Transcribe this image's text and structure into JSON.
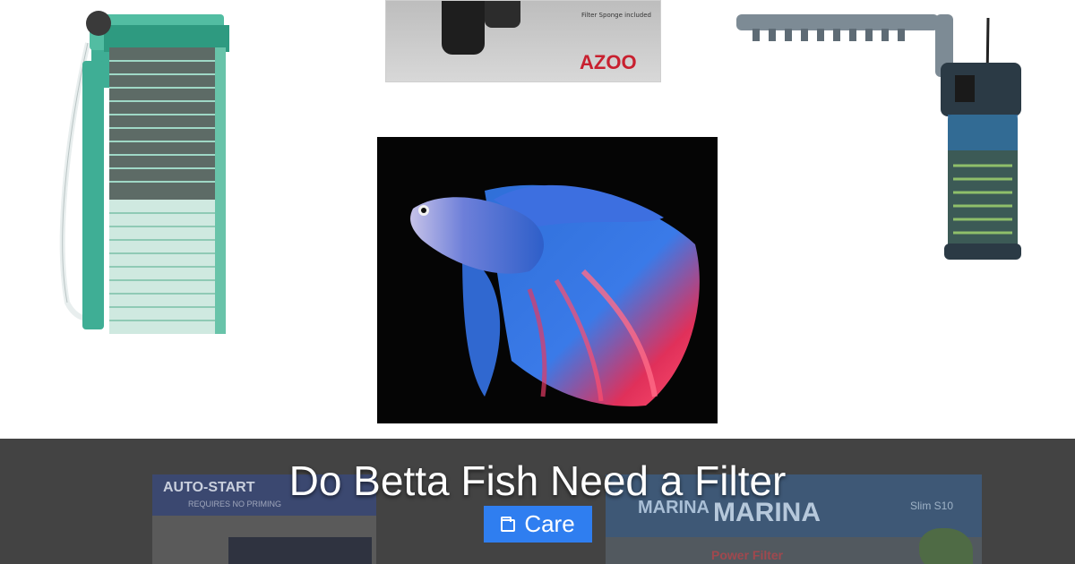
{
  "post": {
    "title": "Do Betta Fish Need a Filter",
    "category_label": "Care"
  },
  "images": {
    "top_box_brand": "AZOO",
    "top_box_note": "Filter Sponge included",
    "bottom_left_box_text": "AUTO-START",
    "bottom_left_box_subtext": "REQUIRES NO PRIMING",
    "bottom_right_box_brand_small": "MARINA",
    "bottom_right_box_brand": "MARINA",
    "bottom_right_box_model": "Slim S10",
    "bottom_right_box_product": "Power Filter"
  },
  "icons": {
    "category": "folder-icon"
  },
  "colors": {
    "overlay_band": "#434343",
    "category_button": "#2f7ef0",
    "title_text": "#ffffff"
  }
}
